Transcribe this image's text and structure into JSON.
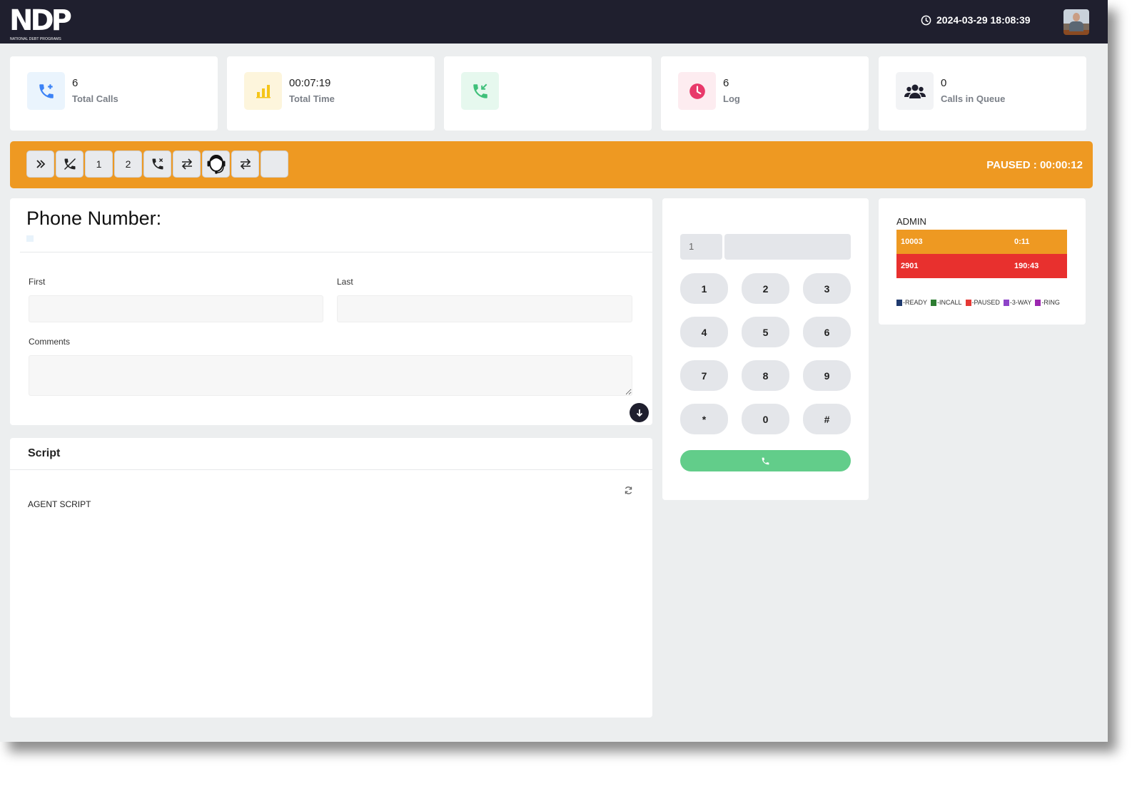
{
  "header": {
    "logo_text": "NDP",
    "logo_subtitle": "NATIONAL DEBT PROGRAMS",
    "datetime": "2024-03-29 18:08:39"
  },
  "stats": [
    {
      "value": "6",
      "label": "Total Calls",
      "icon": "phone-plus-icon",
      "color": "#3b82f6",
      "bg": "#eaf4fd"
    },
    {
      "value": "00:07:19",
      "label": "Total Time",
      "icon": "bar-chart-icon",
      "color": "#f5c518",
      "bg": "#fdf5dc"
    },
    {
      "value": "",
      "label": "",
      "icon": "incoming-call-icon",
      "color": "#3fc07a",
      "bg": "#e6f8ee"
    },
    {
      "value": "6",
      "label": "Log",
      "icon": "clock-icon",
      "color": "#e8396a",
      "bg": "#fdecf0"
    },
    {
      "value": "0",
      "label": "Calls in Queue",
      "icon": "users-icon",
      "color": "#1f1f2e",
      "bg": "#f2f3f5"
    }
  ],
  "toolbar": {
    "buttons": [
      {
        "icon": "double-chevron-right-icon",
        "label": ""
      },
      {
        "icon": "hangup-icon",
        "label": ""
      },
      {
        "icon": "",
        "label": "1"
      },
      {
        "icon": "",
        "label": "2"
      },
      {
        "icon": "phone-x-icon",
        "label": ""
      },
      {
        "icon": "transfer-icon",
        "label": ""
      },
      {
        "icon": "headset-agent-icon",
        "label": ""
      },
      {
        "icon": "transfer-icon",
        "label": ""
      },
      {
        "icon": "",
        "label": ""
      }
    ],
    "status": "PAUSED : 00:00:12"
  },
  "form": {
    "title": "Phone Number:",
    "first_label": "First",
    "first_value": "",
    "last_label": "Last",
    "last_value": "",
    "comments_label": "Comments",
    "comments_value": ""
  },
  "script": {
    "title": "Script",
    "content": "AGENT SCRIPT"
  },
  "dialer": {
    "prefix": "1",
    "number": "",
    "keys": [
      "1",
      "2",
      "3",
      "4",
      "5",
      "6",
      "7",
      "8",
      "9",
      "*",
      "0",
      "#"
    ]
  },
  "admin": {
    "title": "ADMIN",
    "rows": [
      {
        "ext": "10003",
        "time": "0:11",
        "color": "#ee9922"
      },
      {
        "ext": "2901",
        "time": "190:43",
        "color": "#e8302e"
      }
    ],
    "legend": [
      {
        "label": "-READY",
        "color": "#1f3a6e"
      },
      {
        "label": "-INCALL",
        "color": "#2e7d32"
      },
      {
        "label": "-PAUSED",
        "color": "#e53935"
      },
      {
        "label": "-3-WAY",
        "color": "#8e44c8"
      },
      {
        "label": "-RING",
        "color": "#9c27b0"
      }
    ]
  }
}
